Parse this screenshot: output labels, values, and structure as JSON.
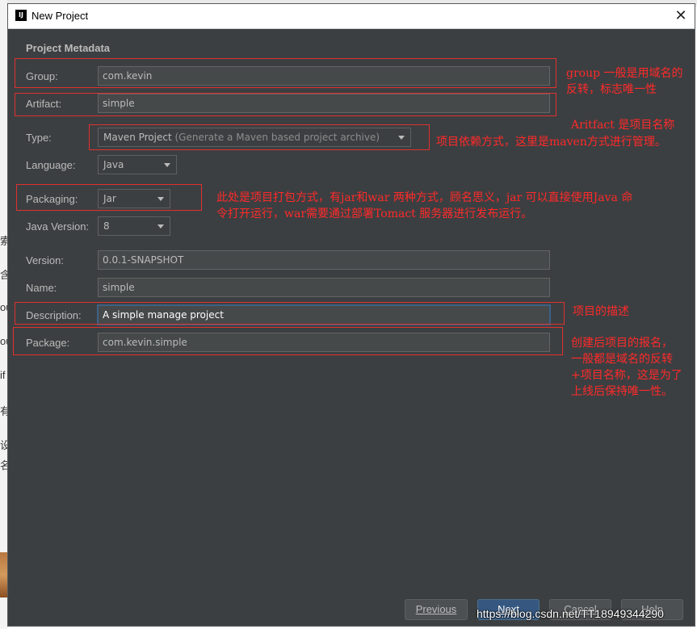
{
  "window": {
    "title": "New Project",
    "icon": "intellij-icon",
    "close": "close-icon"
  },
  "section_title": "Project Metadata",
  "fields": {
    "group": {
      "label": "Group:",
      "value": "com.kevin"
    },
    "artifact": {
      "label": "Artifact:",
      "value": "simple"
    },
    "type": {
      "label": "Type:",
      "value": "Maven Project",
      "hint": "(Generate a Maven based project archive)"
    },
    "language": {
      "label": "Language:",
      "value": "Java"
    },
    "packaging": {
      "label": "Packaging:",
      "value": "Jar"
    },
    "java_version": {
      "label": "Java Version:",
      "value": "8"
    },
    "version": {
      "label": "Version:",
      "value": "0.0.1-SNAPSHOT"
    },
    "name": {
      "label": "Name:",
      "value": "simple"
    },
    "description": {
      "label": "Description:",
      "value": "A simple manage project"
    },
    "package": {
      "label": "Package:",
      "value": "com.kevin.simple"
    }
  },
  "annotations": {
    "group_1": "group 一般是用域名的",
    "group_2": "反转，标志唯一性",
    "artifact": "Aritfact 是项目名称",
    "type": "项目依赖方式，这里是maven方式进行管理。",
    "packaging_1": "此处是项目打包方式，有jar和war 两种方式，顾名思义，jar 可以直接使用Java 命",
    "packaging_2": "令打开运行，war需要通过部署Tomact 服务器进行发布运行。",
    "description": "项目的描述",
    "package_1": "创建后项目的报名，",
    "package_2": "一般都是域名的反转",
    "package_3": "+项目名称，这是为了",
    "package_4": "上线后保持唯一性。"
  },
  "buttons": {
    "previous": "Previous",
    "next": "Next",
    "cancel": "Cancel",
    "help": "Help"
  },
  "watermark": "https://blog.csdn.net/TT18949344290",
  "background_text": [
    "索",
    "含",
    "ou",
    "ou",
    "if",
    "有",
    "设",
    "名"
  ],
  "colors": {
    "dialog_bg": "#3c3f41",
    "annotation": "#ff2a2a",
    "primary_button": "#365880"
  }
}
